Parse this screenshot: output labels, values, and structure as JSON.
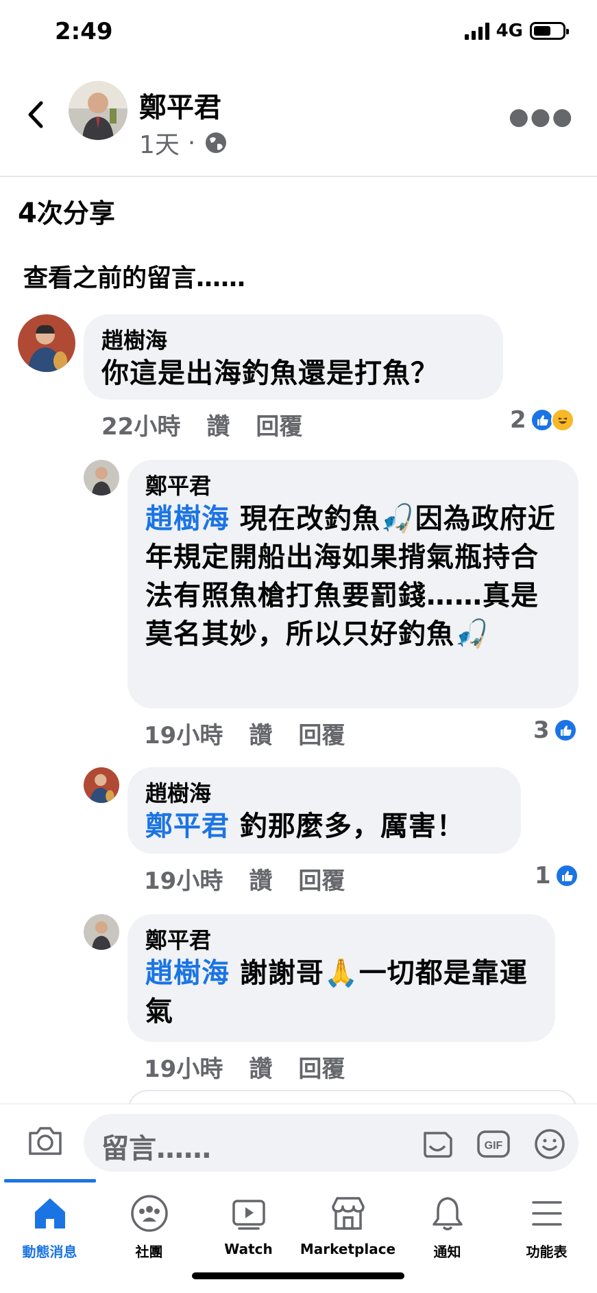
{
  "status": {
    "time": "2:49",
    "network": "4G"
  },
  "header": {
    "name": "鄭平君",
    "time": "1天",
    "separator": "·"
  },
  "post": {
    "shares_num": "4",
    "shares_label": "次分享",
    "view_previous": "查看之前的留言……"
  },
  "comments": [
    {
      "author": "趙樹海",
      "mention": "",
      "text": "你這是出海釣魚還是打魚？",
      "time": "22小時",
      "like": "讚",
      "reply": "回覆",
      "reaction_count": "2"
    },
    {
      "author": "鄭平君",
      "mention": "趙樹海",
      "text": " 現在改釣魚🎣因為政府近年規定開船出海如果揹氣瓶持合法有照魚槍打魚要罰錢……真是莫名其妙，所以只好釣魚🎣",
      "time": "19小時",
      "like": "讚",
      "reply": "回覆",
      "reaction_count": "3"
    },
    {
      "author": "趙樹海",
      "mention": "鄭平君",
      "text": " 釣那麼多，厲害！",
      "time": "19小時",
      "like": "讚",
      "reply": "回覆",
      "reaction_count": "1"
    },
    {
      "author": "鄭平君",
      "mention": "趙樹海",
      "text": " 謝謝哥🙏一切都是靠運氣",
      "time": "19小時",
      "like": "讚",
      "reply": "回覆",
      "reaction_count": ""
    }
  ],
  "input": {
    "placeholder": "留言……"
  },
  "nav": [
    {
      "label": "動態消息",
      "icon": "home-icon"
    },
    {
      "label": "社團",
      "icon": "groups-icon"
    },
    {
      "label": "Watch",
      "icon": "watch-icon"
    },
    {
      "label": "Marketplace",
      "icon": "marketplace-icon"
    },
    {
      "label": "通知",
      "icon": "bell-icon"
    },
    {
      "label": "功能表",
      "icon": "menu-icon"
    }
  ],
  "colors": {
    "accent": "#1b74e4",
    "bubble": "#f0f2f5",
    "muted": "#65676b"
  }
}
